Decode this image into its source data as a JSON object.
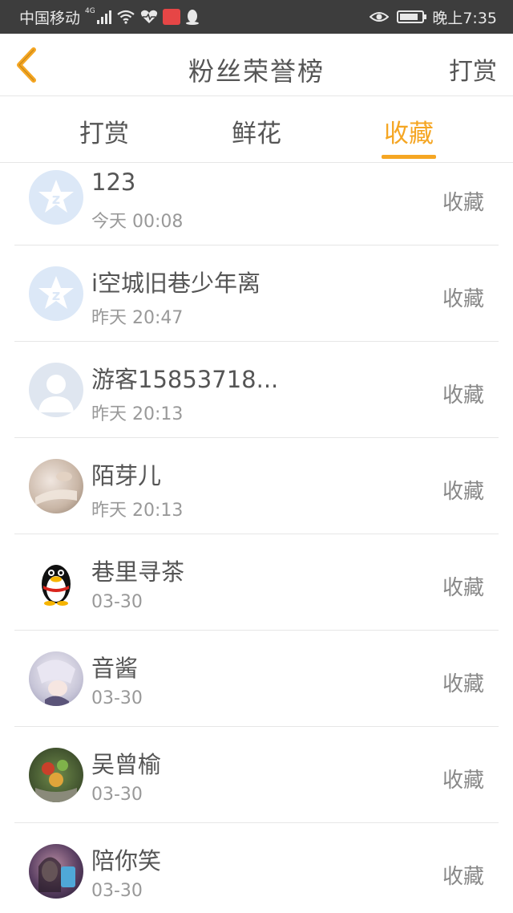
{
  "status_bar": {
    "carrier": "中国移动",
    "network": "4G",
    "time": "晚上7:35"
  },
  "header": {
    "title": "粉丝荣誉榜",
    "right_action": "打赏"
  },
  "tabs": [
    {
      "label": "打赏",
      "active": false
    },
    {
      "label": "鲜花",
      "active": false
    },
    {
      "label": "收藏",
      "active": true
    }
  ],
  "accent_color": "#f5a623",
  "list": [
    {
      "name": "123",
      "time": "今天 00:08",
      "action": "收藏",
      "avatar": "qq-default-icon"
    },
    {
      "name": "i空城旧巷少年离",
      "time": "昨天 20:47",
      "action": "收藏",
      "avatar": "qq-default-icon"
    },
    {
      "name": "游客15853718...",
      "time": "昨天 20:13",
      "action": "收藏",
      "avatar": "default-user-icon"
    },
    {
      "name": "陌芽儿",
      "time": "昨天 20:13",
      "action": "收藏",
      "avatar": "photo-avatar"
    },
    {
      "name": "巷里寻茶",
      "time": "03-30",
      "action": "收藏",
      "avatar": "penguin-avatar"
    },
    {
      "name": "音酱",
      "time": "03-30",
      "action": "收藏",
      "avatar": "anime-avatar"
    },
    {
      "name": "吴曾榆",
      "time": "03-30",
      "action": "收藏",
      "avatar": "food-avatar"
    },
    {
      "name": "陪你笑",
      "time": "03-30",
      "action": "收藏",
      "avatar": "girl-avatar"
    }
  ]
}
